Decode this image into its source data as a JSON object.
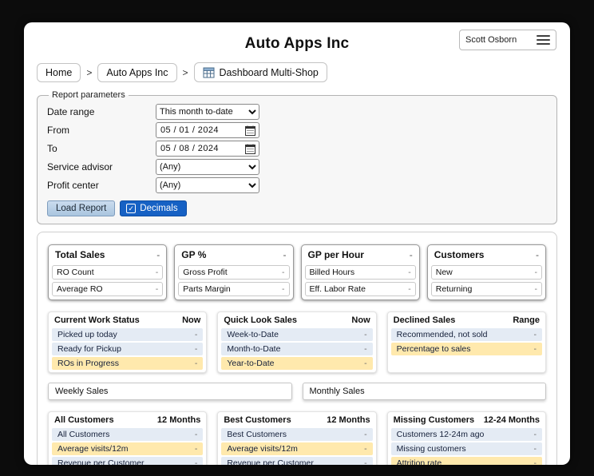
{
  "app": {
    "title": "Auto Apps Inc",
    "user": "Scott Osborn"
  },
  "breadcrumb": {
    "separator": ">",
    "items": [
      "Home",
      "Auto Apps Inc",
      "Dashboard Multi-Shop"
    ]
  },
  "params": {
    "legend": "Report parameters",
    "fields": [
      {
        "label": "Date range",
        "value": "This month to-date"
      },
      {
        "label": "From",
        "value": "05 / 01 / 2024"
      },
      {
        "label": "To",
        "value": "05 / 08 / 2024"
      },
      {
        "label": "Service advisor",
        "value": "(Any)"
      },
      {
        "label": "Profit center",
        "value": "(Any)"
      }
    ],
    "load_label": "Load Report",
    "decimals_label": "Decimals",
    "check_glyph": "✓"
  },
  "kpi_cards": [
    {
      "title": "Total Sales",
      "value": "-",
      "rows": [
        {
          "label": "RO Count",
          "value": "-"
        },
        {
          "label": "Average RO",
          "value": "-"
        }
      ]
    },
    {
      "title": "GP %",
      "value": "-",
      "rows": [
        {
          "label": "Gross Profit",
          "value": "-"
        },
        {
          "label": "Parts Margin",
          "value": "-"
        }
      ]
    },
    {
      "title": "GP per Hour",
      "value": "-",
      "rows": [
        {
          "label": "Billed Hours",
          "value": "-"
        },
        {
          "label": "Eff. Labor Rate",
          "value": "-"
        }
      ]
    },
    {
      "title": "Customers",
      "value": "-",
      "rows": [
        {
          "label": "New",
          "value": "-"
        },
        {
          "label": "Returning",
          "value": "-"
        }
      ]
    }
  ],
  "status_panels": [
    {
      "title": "Current Work Status",
      "range": "Now",
      "rows": [
        {
          "label": "Picked up today",
          "value": "-",
          "highlight": false
        },
        {
          "label": "Ready for Pickup",
          "value": "-",
          "highlight": false
        },
        {
          "label": "ROs in Progress",
          "value": "-",
          "highlight": true
        }
      ]
    },
    {
      "title": "Quick Look Sales",
      "range": "Now",
      "rows": [
        {
          "label": "Week-to-Date",
          "value": "-",
          "highlight": false
        },
        {
          "label": "Month-to-Date",
          "value": "-",
          "highlight": false
        },
        {
          "label": "Year-to-Date",
          "value": "-",
          "highlight": true
        }
      ]
    },
    {
      "title": "Declined Sales",
      "range": "Range",
      "rows": [
        {
          "label": "Recommended, not sold",
          "value": "-",
          "highlight": false
        },
        {
          "label": "Percentage to sales",
          "value": "-",
          "highlight": true
        }
      ]
    }
  ],
  "charts": [
    {
      "title": "Weekly Sales"
    },
    {
      "title": "Monthly Sales"
    }
  ],
  "customer_panels": [
    {
      "title": "All Customers",
      "range": "12 Months",
      "rows": [
        {
          "label": "All Customers",
          "value": "-",
          "highlight": false
        },
        {
          "label": "Average visits/12m",
          "value": "-",
          "highlight": true
        },
        {
          "label": "Revenue per Customer",
          "value": "-",
          "highlight": false
        }
      ]
    },
    {
      "title": "Best Customers",
      "range": "12 Months",
      "rows": [
        {
          "label": "Best Customers",
          "value": "-",
          "highlight": false
        },
        {
          "label": "Average visits/12m",
          "value": "-",
          "highlight": true
        },
        {
          "label": "Revenue per Customer",
          "value": "-",
          "highlight": false
        }
      ]
    },
    {
      "title": "Missing Customers",
      "range": "12-24 Months",
      "rows": [
        {
          "label": "Customers 12-24m ago",
          "value": "-",
          "highlight": false
        },
        {
          "label": "Missing customers",
          "value": "-",
          "highlight": false
        },
        {
          "label": "Attrition rate",
          "value": "-",
          "highlight": true
        }
      ]
    }
  ],
  "colors": {
    "accent_blue": "#1661c4",
    "row_blue": "#e4ebf4",
    "row_highlight": "#ffe9ad",
    "background": "#0c0c0c"
  }
}
